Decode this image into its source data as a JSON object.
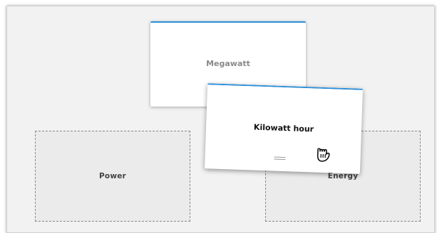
{
  "dropzones": [
    {
      "label": "Power"
    },
    {
      "label": "Energy"
    }
  ],
  "cards": [
    {
      "label": "Megawatt",
      "state": "placed"
    },
    {
      "label": "Kilowatt hour",
      "state": "dragging"
    }
  ],
  "accent_color": "#2b8fd9",
  "icons": [
    "drag-grip-icon",
    "grab-hand-cursor-icon"
  ]
}
